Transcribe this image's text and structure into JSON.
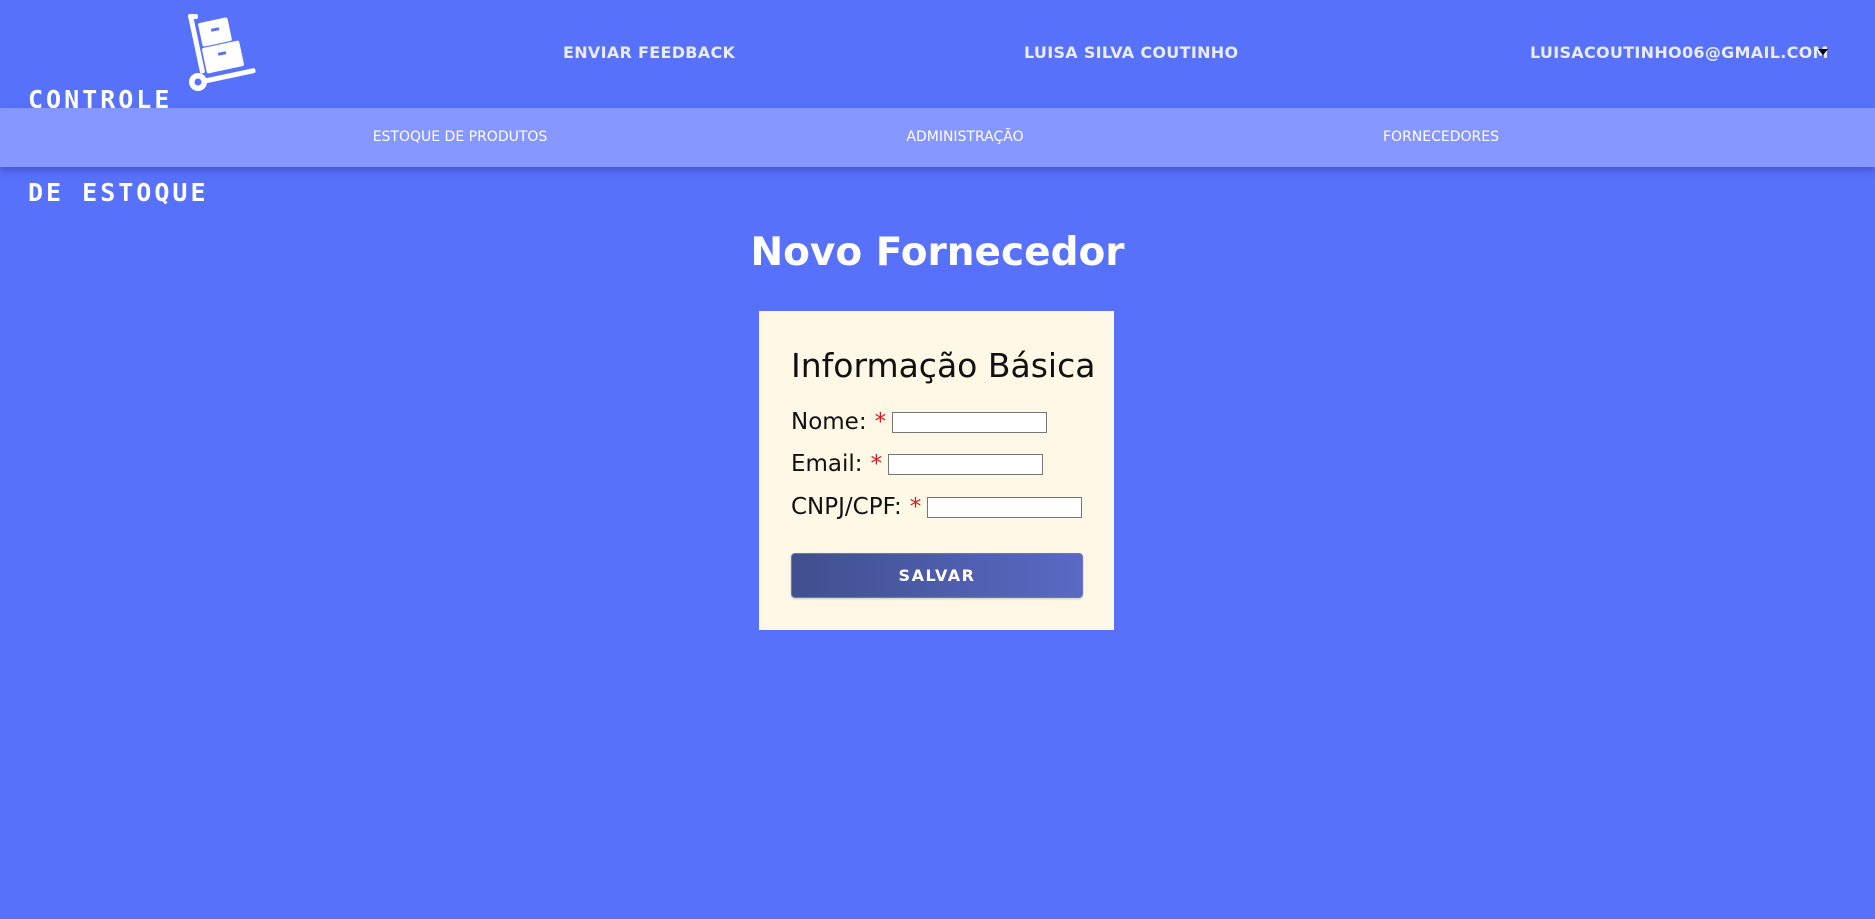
{
  "header": {
    "logo_lines": [
      "CONTROLE",
      "DE ESTOQUE"
    ],
    "logo_icon": "hand-truck-boxes-icon",
    "feedback_label": "ENVIAR FEEDBACK",
    "user_name": "LUISA SILVA COUTINHO",
    "user_email": "LUISACOUTINHO06@GMAIL.COM",
    "user_menu_icon": "caret-down-icon"
  },
  "nav": {
    "items": [
      {
        "label": "ESTOQUE DE PRODUTOS"
      },
      {
        "label": "ADMINISTRAÇÃO"
      },
      {
        "label": "FORNECEDORES"
      }
    ]
  },
  "page": {
    "title": "Novo Fornecedor"
  },
  "form": {
    "section_title": "Informação Básica",
    "required_marker": "*",
    "fields": [
      {
        "label": "Nome:",
        "value": "",
        "placeholder": ""
      },
      {
        "label": "Email:",
        "value": "",
        "placeholder": ""
      },
      {
        "label": "CNPJ/CPF:",
        "value": "",
        "placeholder": ""
      }
    ],
    "submit_label": "SALVAR"
  },
  "colors": {
    "background": "#5771fb",
    "nav_bar": "#8697ff",
    "card": "#fff8e6",
    "required": "#d41c1c",
    "button_start": "#414f8f",
    "button_end": "#5a69c4"
  }
}
